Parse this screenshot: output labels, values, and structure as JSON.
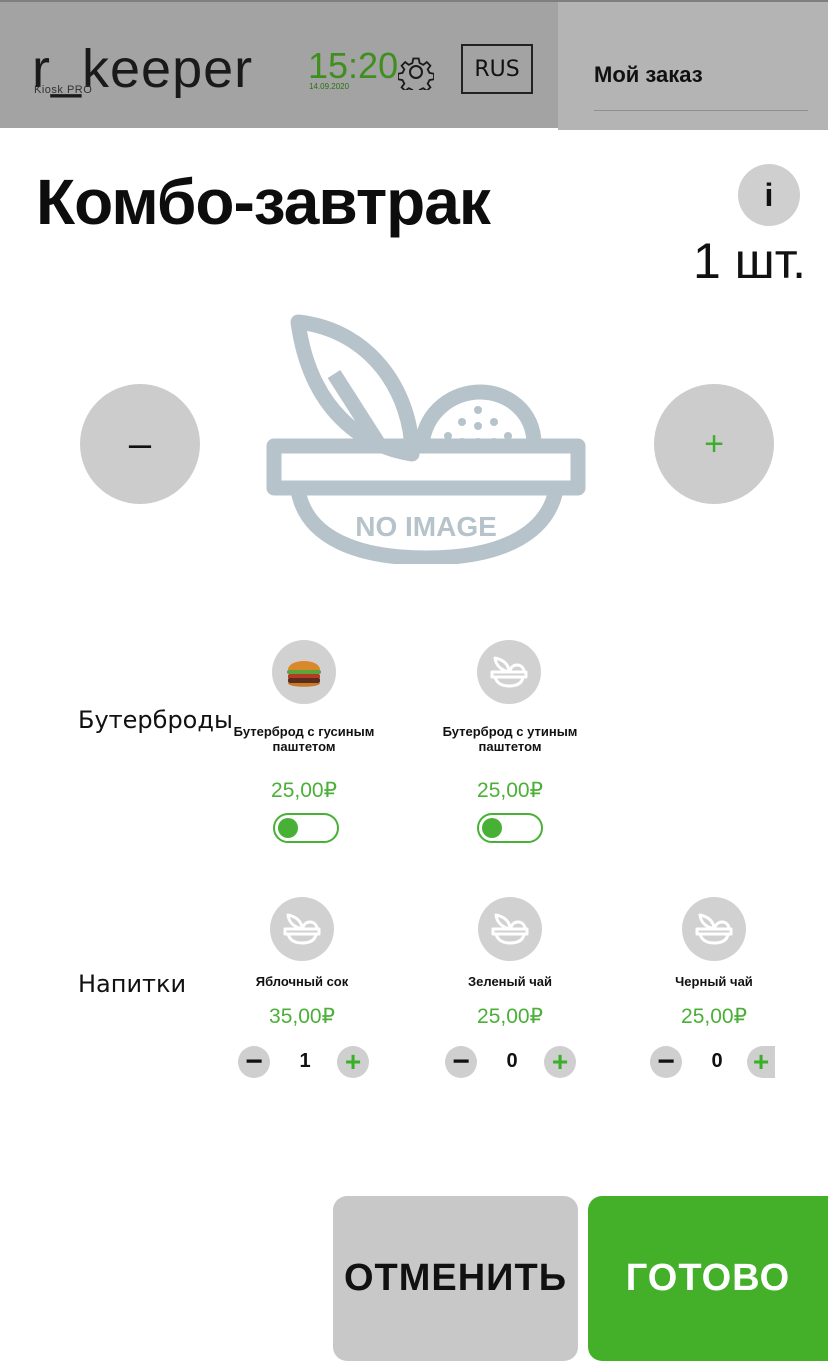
{
  "header": {
    "brand": "r_keeper",
    "brand_sub": "Kiosk PRO",
    "time": "15:20",
    "date": "14.09.2020",
    "language": "RUS",
    "order_title": "Мой заказ"
  },
  "product": {
    "title": "Комбо-завтрак",
    "info_label": "i",
    "quantity": "1 шт.",
    "minus_label": "–",
    "plus_label": "+",
    "image_placeholder": "NO IMAGE"
  },
  "groups": [
    {
      "label": "Бутерброды",
      "items": [
        {
          "name": "Бутерброд с гусиным паштетом",
          "price": "25,00₽",
          "image": "burger-photo",
          "toggle_on": true
        },
        {
          "name": "Бутерброд с утиным паштетом",
          "price": "25,00₽",
          "image": "no-image-icon",
          "toggle_on": true
        }
      ]
    },
    {
      "label": "Напитки",
      "items": [
        {
          "name": "Яблочный сок",
          "price": "35,00₽",
          "image": "no-image-icon",
          "count": "1"
        },
        {
          "name": "Зеленый чай",
          "price": "25,00₽",
          "image": "no-image-icon",
          "count": "0"
        },
        {
          "name": "Черный чай",
          "price": "25,00₽",
          "image": "no-image-icon",
          "count": "0"
        }
      ]
    }
  ],
  "stepper": {
    "dec_label": "−",
    "inc_label": "+"
  },
  "actions": {
    "cancel": "ОТМЕНИТЬ",
    "done": "ГОТОВО"
  },
  "colors": {
    "accent_green": "#44b02a",
    "header_bg": "#a3a3a3",
    "button_gray": "#c8c8c8"
  }
}
